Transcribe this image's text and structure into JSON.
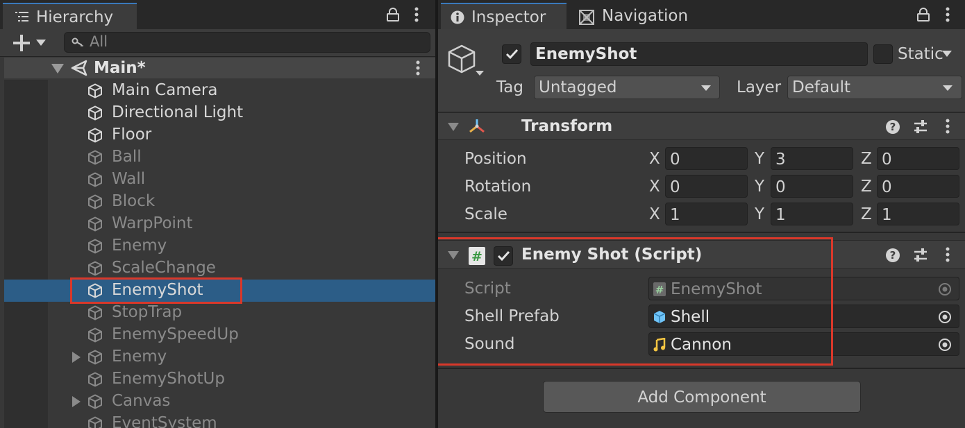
{
  "hierarchy": {
    "tab_label": "Hierarchy",
    "search_placeholder": "All",
    "scene_name": "Main*",
    "items": [
      {
        "label": "Main Camera",
        "active": true
      },
      {
        "label": "Directional Light",
        "active": true
      },
      {
        "label": "Floor",
        "active": true
      },
      {
        "label": "Ball",
        "active": false
      },
      {
        "label": "Wall",
        "active": false
      },
      {
        "label": "Block",
        "active": false
      },
      {
        "label": "WarpPoint",
        "active": false
      },
      {
        "label": "Enemy",
        "active": false
      },
      {
        "label": "ScaleChange",
        "active": false
      },
      {
        "label": "EnemyShot",
        "active": true,
        "selected": true
      },
      {
        "label": "StopTrap",
        "active": false
      },
      {
        "label": "EnemySpeedUp",
        "active": false
      },
      {
        "label": "Enemy",
        "active": false,
        "expandable": true
      },
      {
        "label": "EnemyShotUp",
        "active": false
      },
      {
        "label": "Canvas",
        "active": false,
        "expandable": true
      },
      {
        "label": "EventSystem",
        "active": false
      }
    ]
  },
  "inspector": {
    "tabs": [
      {
        "label": "Inspector",
        "icon": "info-icon",
        "active": true
      },
      {
        "label": "Navigation",
        "icon": "navmesh-icon",
        "active": false
      }
    ],
    "object": {
      "enabled": true,
      "name": "EnemyShot",
      "static_label": "Static",
      "static_checked": false,
      "tag_label": "Tag",
      "tag_value": "Untagged",
      "layer_label": "Layer",
      "layer_value": "Default"
    },
    "transform": {
      "title": "Transform",
      "rows": [
        {
          "label": "Position",
          "x": "0",
          "y": "3",
          "z": "0"
        },
        {
          "label": "Rotation",
          "x": "0",
          "y": "0",
          "z": "0"
        },
        {
          "label": "Scale",
          "x": "1",
          "y": "1",
          "z": "1"
        }
      ],
      "axis_labels": [
        "X",
        "Y",
        "Z"
      ]
    },
    "script_component": {
      "title": "Enemy Shot (Script)",
      "enabled": true,
      "fields": [
        {
          "label": "Script",
          "value": "EnemyShot",
          "icon": "csharp-script-icon",
          "readonly": true
        },
        {
          "label": "Shell Prefab",
          "value": "Shell",
          "icon": "prefab-icon",
          "readonly": false
        },
        {
          "label": "Sound",
          "value": "Cannon",
          "icon": "audio-clip-icon",
          "readonly": false
        }
      ]
    },
    "add_component_label": "Add Component"
  },
  "colors": {
    "selection": "#2c5d87",
    "highlight_box": "#d9382a",
    "tab_accent": "#3a79bb",
    "prefab_blue": "#6fc3f7",
    "audio_yellow": "#f4c542",
    "script_green": "#3c9a45"
  }
}
